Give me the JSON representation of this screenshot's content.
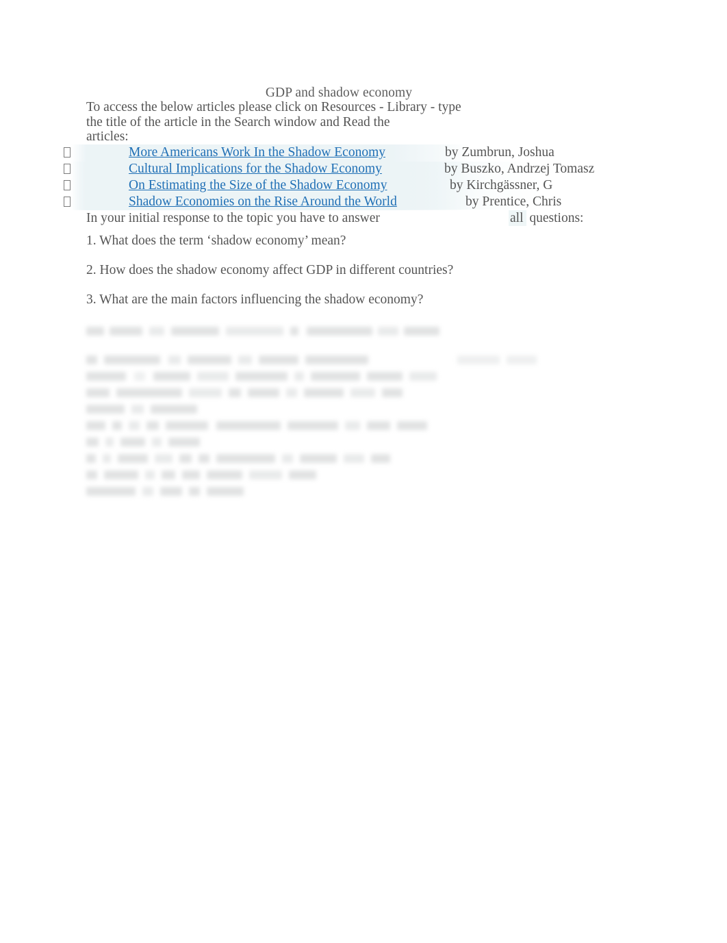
{
  "document": {
    "title": "GDP and shadow economy",
    "intro_lines": [
      "To access the below articles please click on Resources - Library - type",
      "the title of the article in the Search window and Read the",
      "articles:"
    ],
    "articles": [
      {
        "bullet": "missing-glyph-box",
        "title": "More Americans Work In the Shadow Economy",
        "byline": "by Zumbrun, Joshua"
      },
      {
        "bullet": "missing-glyph-box",
        "title": "Cultural Implications for the Shadow Economy",
        "byline": "by Buszko, Andrzej Tomasz"
      },
      {
        "bullet": "missing-glyph-box",
        "title": "On Estimating the Size of the Shadow Economy",
        "byline": "by Kirchgässner, G"
      },
      {
        "bullet": "missing-glyph-box",
        "title": "Shadow Economies on the Rise Around the World",
        "byline": "by Prentice, Chris"
      }
    ],
    "response_instruction": {
      "lead": "In your initial response to the topic you have to answer",
      "emphasis": "all",
      "trail": "questions:"
    },
    "questions": [
      "1. What does the term ‘shadow economy’ mean?",
      "2. How does the shadow economy affect GDP in different countries?",
      "3. What are the main factors influencing the shadow economy?"
    ],
    "obscured_note": "Remaining text in the lower half of the page is blurred and illegible."
  },
  "colors": {
    "link": "#1F6FB5",
    "body_text": "#545454",
    "title_text": "#5C5C5C",
    "highlight": "#ECF4F6",
    "page_background": "#FFFFFF"
  }
}
